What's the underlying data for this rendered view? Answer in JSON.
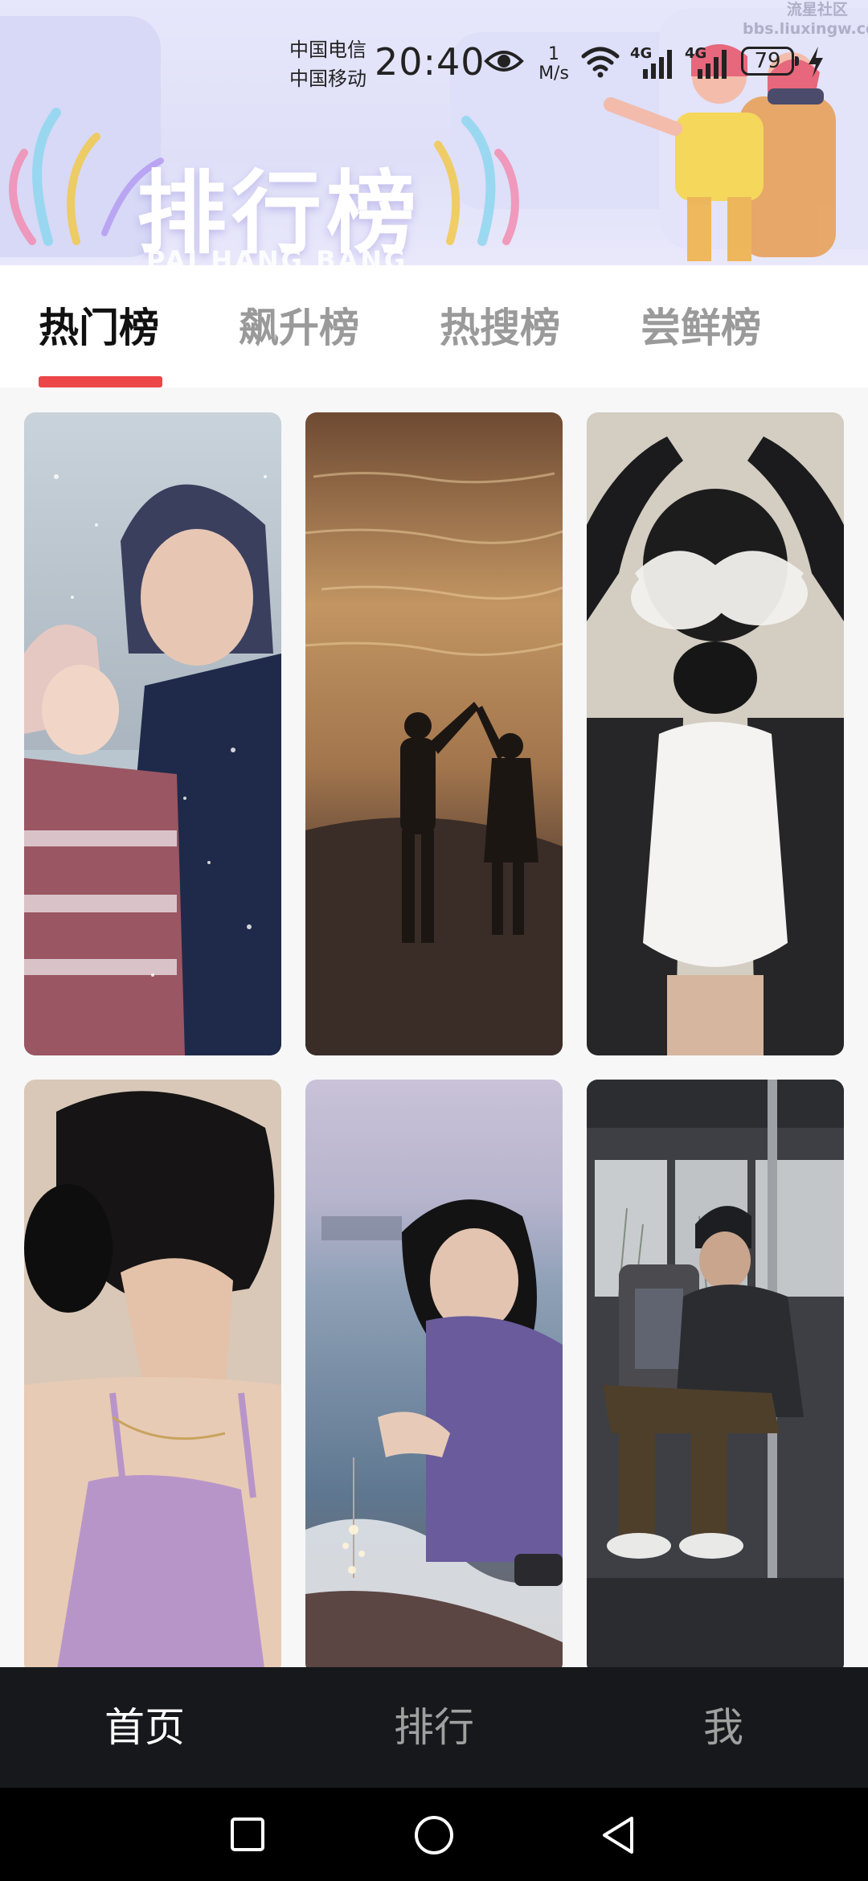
{
  "status_bar": {
    "carrier_1": "中国电信",
    "carrier_2": "中国移动",
    "time": "20:40",
    "net_speed_value": "1",
    "net_speed_unit": "M/s",
    "signal_1_label": "4G",
    "signal_2_label": "4G",
    "battery_level": "79",
    "icons": [
      "eye-icon",
      "wifi-icon",
      "signal-icon",
      "signal-icon",
      "battery-icon",
      "charging-icon"
    ]
  },
  "watermark": {
    "line1": "流星社区",
    "line2": "bbs.liuxingw.com"
  },
  "banner": {
    "title": "排行榜",
    "subtitle": "PAI HANG BANG"
  },
  "tabs": {
    "items": [
      {
        "label": "热门榜",
        "active": true
      },
      {
        "label": "飙升榜",
        "active": false
      },
      {
        "label": "热搜榜",
        "active": false
      },
      {
        "label": "尝鲜榜",
        "active": false
      }
    ],
    "indicator_color": "#ec4649"
  },
  "grid": {
    "cards": [
      {
        "image": "couple-in-snow-photo"
      },
      {
        "image": "couple-dancing-beach-sunset-photo"
      },
      {
        "image": "girl-hair-scrunchie-back-photo"
      },
      {
        "image": "girl-hair-bun-lilac-top-photo"
      },
      {
        "image": "girl-sparkler-seaside-photo"
      },
      {
        "image": "person-sitting-on-bus-photo"
      }
    ]
  },
  "bottom_nav": {
    "items": [
      {
        "label": "首页",
        "active": true
      },
      {
        "label": "排行",
        "active": false
      },
      {
        "label": "我",
        "active": false
      }
    ]
  },
  "system_nav": {
    "icons": [
      "recents-square-icon",
      "home-circle-icon",
      "back-triangle-icon"
    ]
  },
  "colors": {
    "accent": "#ec4649",
    "nav_background": "#16181b",
    "banner_background": "#e4e5fa"
  }
}
